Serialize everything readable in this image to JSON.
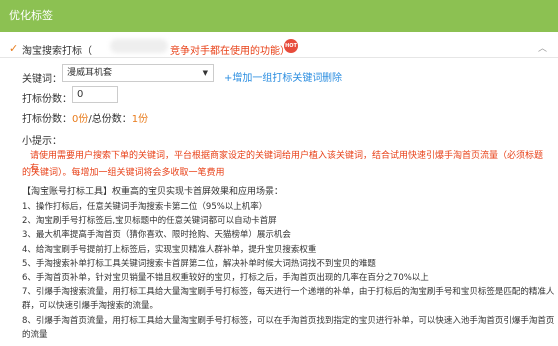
{
  "header": {
    "title": "优化标签"
  },
  "option": {
    "title": "淘宝搜索打标（",
    "note": "竞争对手都在使用的功能）",
    "hot_badge": "HOT"
  },
  "keyword": {
    "label": "关键词：",
    "selected": "漫威耳机套",
    "add_link": "+增加一组打标关键词",
    "delete_link": "删除"
  },
  "count": {
    "label": "打标份数：",
    "value": "0"
  },
  "stats": {
    "label1": "打标份数：",
    "v1": "0份",
    "sep": "/总份数：",
    "v2": "1份"
  },
  "tips": {
    "title": "小提示：",
    "warning": "请使用需要用户搜索下单的关键词，平台根据商家设定的关键词给用户植入该关键词，结合试用快速引爆手淘首页流量（必须标题有",
    "warning2": "的关键词）。每增加一组关键词将会多收取一笔费用",
    "tool_title": "【淘宝账号打标工具】权重高的宝贝实现卡首屏效果和应用场景：",
    "items": [
      "1、操作打标后，任意关键词手淘搜索卡第二位（95%以上机率）",
      "2、淘宝刷手号打标签后,宝贝标题中的任意关键词都可以自动卡首屏",
      "3、最大机率提高手淘首页（猜你喜欢、限时抢购、天猫榜单）展示机会",
      "4、给淘宝刷手号提前打上标签后，实现宝贝精准人群补单，提升宝贝搜索权重",
      "5、手淘搜索补单打标工具关键词搜索卡首屏第二位，解决补单时候大词热词找不到宝贝的难题",
      "6、手淘首页补单，针对宝贝销量不错且权重较好的宝贝，打标之后，手淘首页出现的几率在百分之70%以上",
      "7、引爆手淘搜索流量，用打标工具给大量淘宝刷手号打标签，每天进行一个递增的补单，由于打标后的淘宝刷手号和宝贝标签是匹配的精准人群，可以快速引爆手淘搜索的流量。",
      "8、引爆手淘首页流量，用打标工具给大量淘宝刷手号打标签，可以在手淘首页找到指定的宝贝进行补单，可以快速入池手淘首页引爆手淘首页的流量"
    ]
  }
}
